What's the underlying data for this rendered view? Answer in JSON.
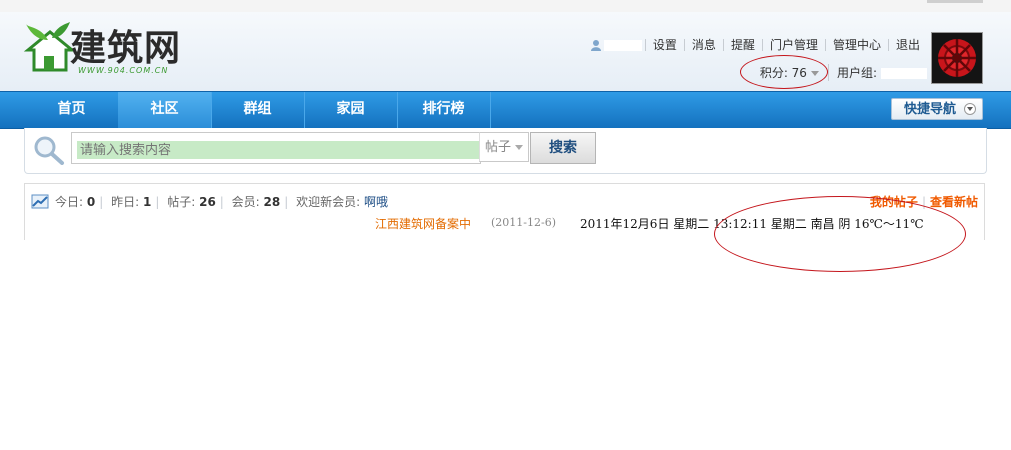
{
  "header": {
    "logo_text": "建筑网",
    "logo_sub": "WWW.904.COM.CN",
    "user_links": [
      "设置",
      "消息",
      "提醒",
      "门户管理",
      "管理中心",
      "退出"
    ],
    "points_label": "积分: 76",
    "usergroup_label": "用户组:"
  },
  "nav": {
    "items": [
      "首页",
      "社区",
      "群组",
      "家园",
      "排行榜"
    ],
    "active": "社区",
    "quick_nav": "快捷导航"
  },
  "search": {
    "placeholder": "请输入搜索内容",
    "type": "帖子",
    "button": "搜索"
  },
  "stats": {
    "today_label": "今日:",
    "today": "0",
    "yesterday_label": "昨日:",
    "yesterday": "1",
    "posts_label": "帖子:",
    "posts": "26",
    "members_label": "会员:",
    "members": "28",
    "welcome_label": "欢迎新会员:",
    "new_member": "啊哦",
    "my_posts": "我的帖子",
    "new_posts": "查看新帖",
    "notice": "江西建筑网备案中",
    "notice_date": "(2011-12-6)",
    "date_weather": "2011年12月6日 星期二 13:12:11 星期二 南昌  阴 16℃～11℃"
  },
  "colors": {
    "nav_blue": "#1f86d4",
    "accent_orange": "#f05a00",
    "annotation_red": "#c4161c"
  }
}
